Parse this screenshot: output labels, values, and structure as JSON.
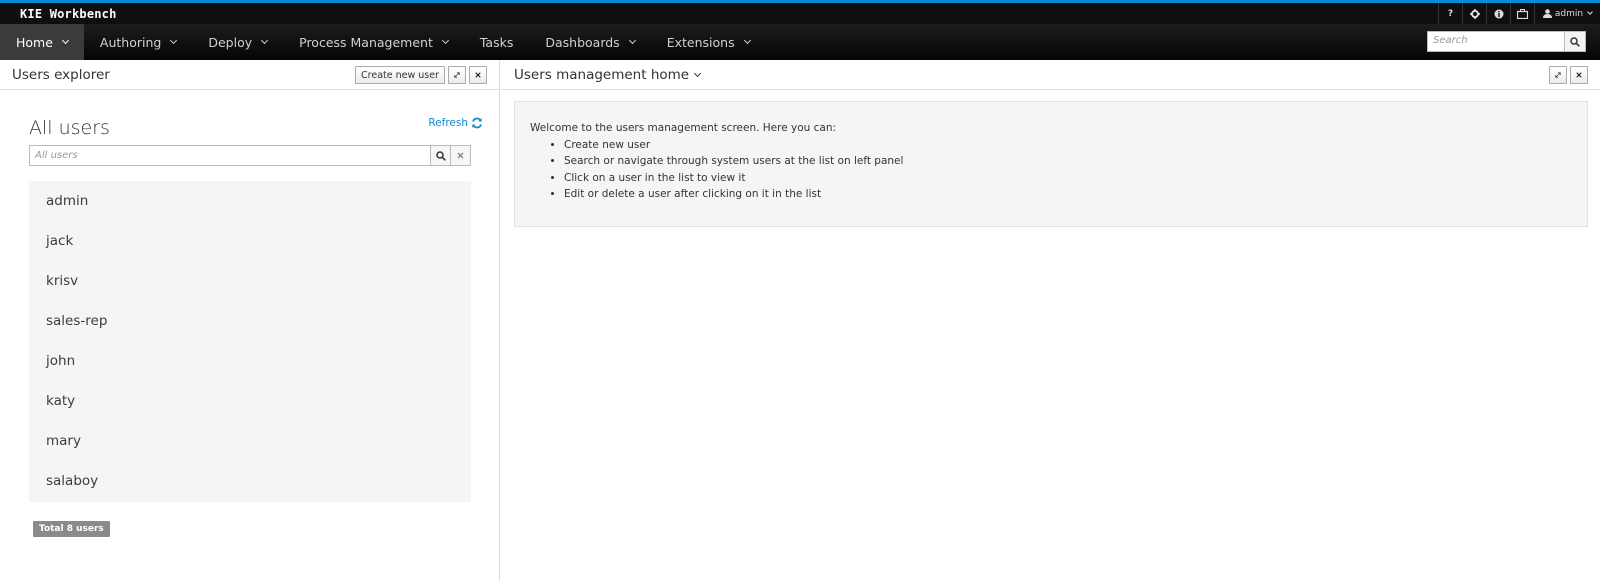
{
  "app": {
    "brand": "KIE Workbench"
  },
  "utility": {
    "help": "?",
    "user_label": "admin"
  },
  "nav": {
    "items": [
      {
        "label": "Home",
        "dropdown": true,
        "active": true
      },
      {
        "label": "Authoring",
        "dropdown": true
      },
      {
        "label": "Deploy",
        "dropdown": true
      },
      {
        "label": "Process Management",
        "dropdown": true
      },
      {
        "label": "Tasks",
        "dropdown": false
      },
      {
        "label": "Dashboards",
        "dropdown": true
      },
      {
        "label": "Extensions",
        "dropdown": true
      }
    ],
    "search_placeholder": "Search"
  },
  "left_panel": {
    "title": "Users explorer",
    "create_button": "Create new user",
    "users_title": "All users",
    "refresh_label": "Refresh",
    "search_placeholder": "All users",
    "users": [
      "admin",
      "jack",
      "krisv",
      "sales-rep",
      "john",
      "katy",
      "mary",
      "salaboy"
    ],
    "total_label": "Total 8 users"
  },
  "right_panel": {
    "title": "Users management home",
    "welcome_intro": "Welcome to the users management screen. Here you can:",
    "bullets": [
      "Create new user",
      "Search or navigate through system users at the list on left panel",
      "Click on a user in the list to view it",
      "Edit or delete a user after clicking on it in the list"
    ]
  },
  "colors": {
    "accent": "#0a8bd6",
    "topbar": "#0f0f0f",
    "nav_active": "#3b3b3b"
  }
}
